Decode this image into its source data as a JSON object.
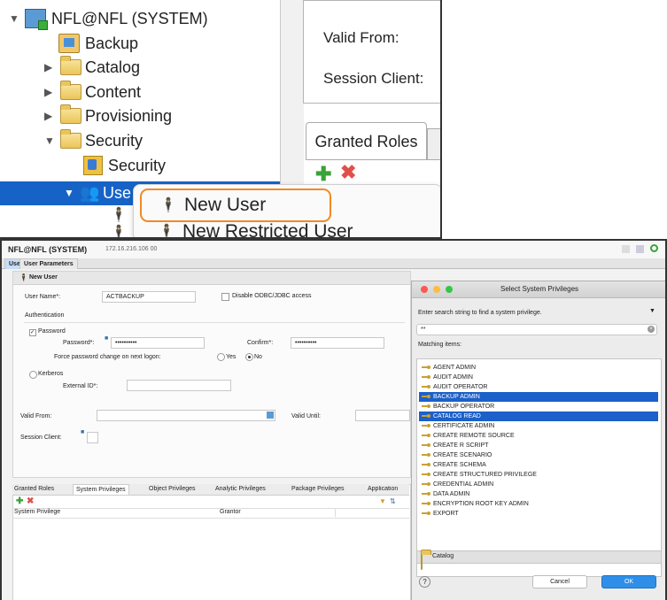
{
  "tree": {
    "root": "NFL@NFL (SYSTEM)",
    "items": [
      "Backup",
      "Catalog",
      "Content",
      "Provisioning",
      "Security",
      "Security",
      "Use"
    ]
  },
  "top_right": {
    "valid_from": "Valid From:",
    "session_client": "Session Client:",
    "tab_granted_roles": "Granted Roles"
  },
  "context_menu": {
    "new_user": "New User",
    "new_restricted_user": "New Restricted User"
  },
  "editor": {
    "title": "NFL@NFL (SYSTEM)",
    "host": "172.16.216.106 00",
    "tabs": [
      "User",
      "User Parameters"
    ],
    "section": "New User",
    "user_name_label": "User Name*:",
    "user_name_value": "ACTBACKUP",
    "disable_odbc": "Disable ODBC/JDBC access",
    "authentication": "Authentication",
    "password": "Password",
    "password_label": "Password*:",
    "password_value": "••••••••••",
    "confirm_label": "Confirm*:",
    "confirm_value": "••••••••••",
    "force_change": "Force password change on next logon:",
    "yes": "Yes",
    "no": "No",
    "kerberos": "Kerberos",
    "external_id": "External ID*:",
    "valid_from": "Valid From:",
    "valid_until": "Valid Until:",
    "session_client": "Session Client:",
    "priv_tabs": [
      "Granted Roles",
      "System Privileges",
      "Object Privileges",
      "Analytic Privileges",
      "Package Privileges",
      "Application"
    ],
    "col_privilege": "System Privilege",
    "col_grantor": "Grantor"
  },
  "dialog": {
    "title": "Select System Privileges",
    "hint": "Enter search string to find a system privilege.",
    "search_value": "**",
    "matching": "Matching items:",
    "items": [
      "AGENT ADMIN",
      "AUDIT ADMIN",
      "AUDIT OPERATOR",
      "BACKUP ADMIN",
      "BACKUP OPERATOR",
      "CATALOG READ",
      "CERTIFICATE ADMIN",
      "CREATE REMOTE SOURCE",
      "CREATE R SCRIPT",
      "CREATE SCENARIO",
      "CREATE SCHEMA",
      "CREATE STRUCTURED PRIVILEGE",
      "CREDENTIAL ADMIN",
      "DATA ADMIN",
      "ENCRYPTION ROOT KEY ADMIN",
      "EXPORT"
    ],
    "selected": [
      "BACKUP ADMIN",
      "CATALOG READ"
    ],
    "location": "Catalog",
    "cancel": "Cancel",
    "ok": "OK",
    "help": "?"
  },
  "colors": {
    "selection": "#1663c7",
    "highlight_ring": "#f08a24",
    "ok_button": "#2f8fe8"
  }
}
